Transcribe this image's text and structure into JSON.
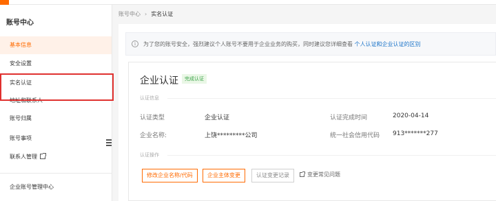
{
  "sidebar": {
    "title": "账号中心",
    "items": [
      {
        "label": "基本信息",
        "active": true
      },
      {
        "label": "安全设置"
      },
      {
        "label": "实名认证"
      },
      {
        "label": "地址和联系人"
      },
      {
        "label": "账号归属"
      },
      {
        "label": "账号事项"
      },
      {
        "label": "联系人管理",
        "external": true
      },
      {
        "label": "企业账号管理中心"
      }
    ]
  },
  "breadcrumb": {
    "root": "账号中心",
    "separator": "›",
    "current": "实名认证"
  },
  "notice": {
    "icon": "info-icon",
    "text": "为了您的账号安全，强烈建议个人账号不要用于企业业务的购买，同时建议您详细查看",
    "link": "个人认证和企业认证的区别"
  },
  "card": {
    "title": "企业认证",
    "status_tag": "完成认证",
    "section_info": "认证信息",
    "section_ops": "认证操作",
    "fields": {
      "type_label": "认证类型",
      "type_value": "企业认证",
      "time_label": "认证完成时间",
      "time_value": "2020-04-14",
      "name_label": "企业名称:",
      "name_value": "上饶*********公司",
      "code_label": "统一社会信用代码",
      "code_value": "913*******277"
    },
    "buttons": {
      "modify": "修改企业名称/代码",
      "subject_change": "企业主体变更",
      "records": "认证变更记录"
    },
    "faq": "变更常见问题"
  },
  "colors": {
    "accent": "#ff6a00",
    "highlight": "#e0302e",
    "link": "#1a73c8",
    "success": "#3ca34a"
  }
}
